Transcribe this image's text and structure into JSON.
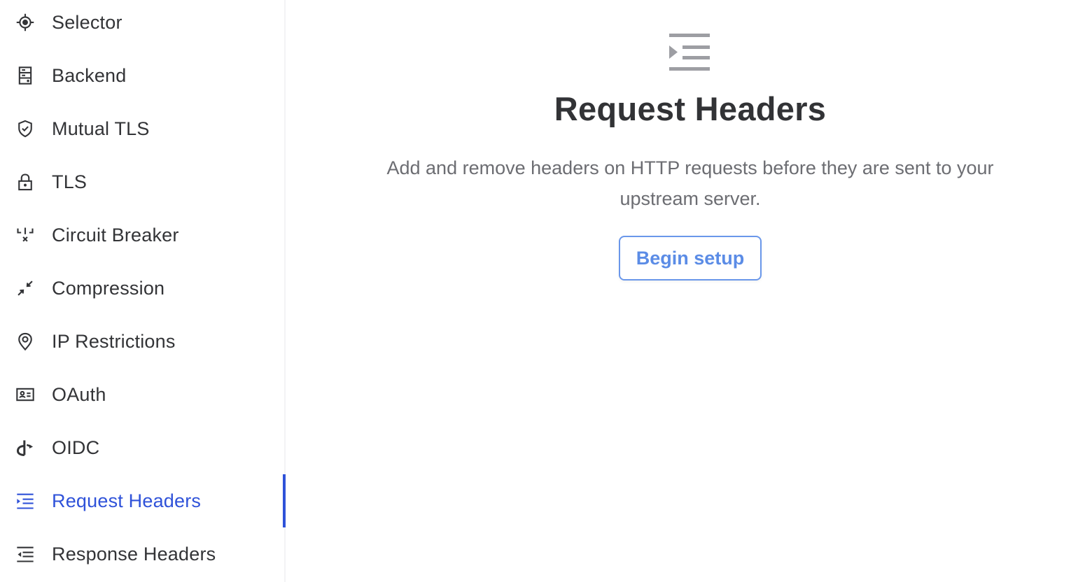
{
  "sidebar": {
    "items": [
      {
        "label": "Selector",
        "icon": "crosshair-icon",
        "active": false
      },
      {
        "label": "Backend",
        "icon": "server-icon",
        "active": false
      },
      {
        "label": "Mutual TLS",
        "icon": "shield-check-icon",
        "active": false
      },
      {
        "label": "TLS",
        "icon": "lock-icon",
        "active": false
      },
      {
        "label": "Circuit Breaker",
        "icon": "circuit-breaker-icon",
        "active": false
      },
      {
        "label": "Compression",
        "icon": "compress-arrows-icon",
        "active": false
      },
      {
        "label": "IP Restrictions",
        "icon": "map-pin-icon",
        "active": false
      },
      {
        "label": "OAuth",
        "icon": "id-card-icon",
        "active": false
      },
      {
        "label": "OIDC",
        "icon": "openid-icon",
        "active": false
      },
      {
        "label": "Request Headers",
        "icon": "indent-right-icon",
        "active": true
      },
      {
        "label": "Response Headers",
        "icon": "indent-left-icon",
        "active": false
      }
    ]
  },
  "main": {
    "icon": "indent-right-icon",
    "title": "Request Headers",
    "description": "Add and remove headers on HTTP requests before they are sent to your upstream server.",
    "begin_button": "Begin setup"
  },
  "colors": {
    "accent": "#2f52d9",
    "button_border": "#6a97ea",
    "button_text": "#5b8ce6",
    "text": "#333437",
    "muted": "#6c6d72",
    "hero_icon": "#9d9ea3"
  }
}
